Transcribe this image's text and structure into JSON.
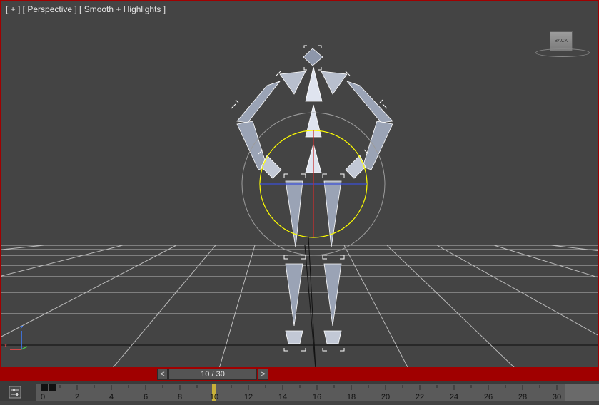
{
  "viewport": {
    "label": "[ + ] [ Perspective ] [ Smooth + Highlights ]",
    "viewcube_label": "BACK",
    "axis_labels": {
      "z": "z",
      "x": "x"
    },
    "active_border_color": "#a00000"
  },
  "time_slider": {
    "prev_icon": "<",
    "next_icon": ">",
    "frame_text": "10 / 30",
    "current_frame": 10,
    "total_frames": 30
  },
  "track_bar": {
    "toggle_icon": "track-bar-toggle-icon",
    "ticks": [
      "0",
      "2",
      "4",
      "6",
      "8",
      "10",
      "12",
      "14",
      "16",
      "18",
      "20",
      "22",
      "24",
      "26",
      "28",
      "30"
    ],
    "keyframes": [
      0,
      0.5
    ],
    "current_frame": 10
  },
  "colors": {
    "viewport_bg": "#444444",
    "grid": "#cfcfcf",
    "bones": "#9aa3b5",
    "selection": "#ffffff",
    "gizmo_circle": "#ffff00",
    "gizmo_x": "#3b4fd8",
    "gizmo_y": "#c83030"
  }
}
